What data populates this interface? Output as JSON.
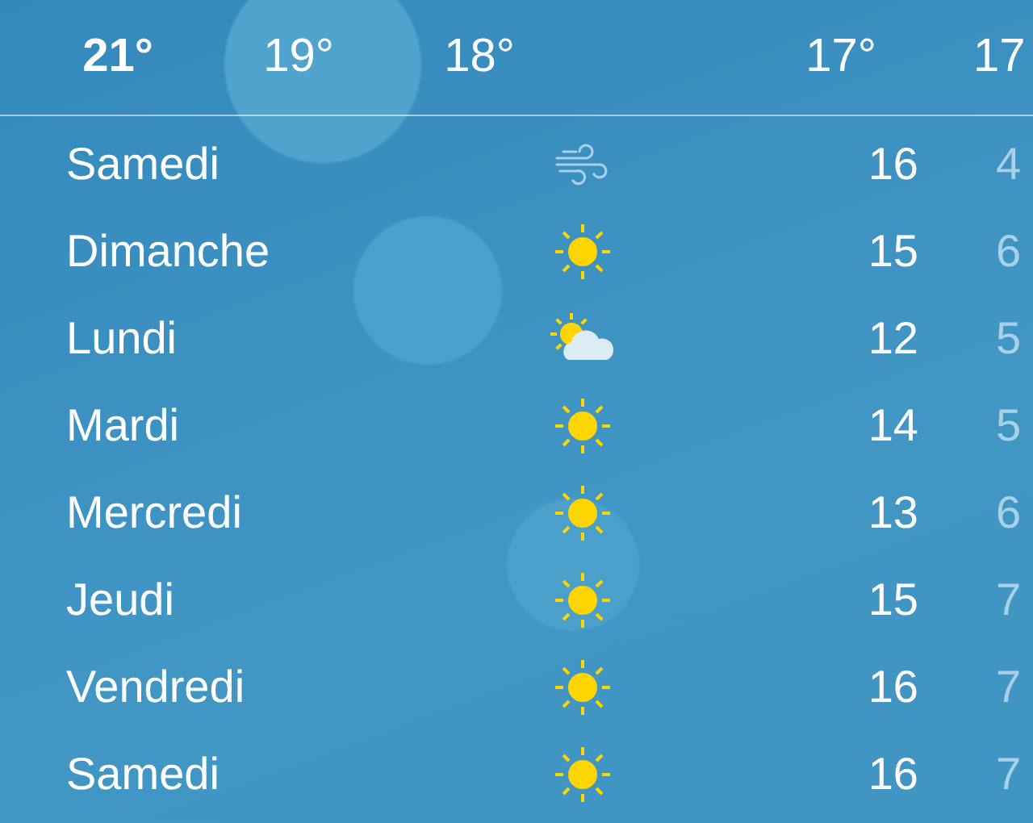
{
  "hourly": [
    {
      "temp": "21°",
      "selected": true
    },
    {
      "temp": "19°",
      "selected": false
    },
    {
      "temp": "18°",
      "selected": false
    },
    {
      "temp": "17°",
      "selected": false
    },
    {
      "temp": "17",
      "selected": false
    }
  ],
  "days": [
    {
      "day": "Samedi",
      "kind": "wind",
      "high": "16",
      "low": "4"
    },
    {
      "day": "Dimanche",
      "kind": "sun",
      "high": "15",
      "low": "6"
    },
    {
      "day": "Lundi",
      "kind": "partly-cloudy",
      "high": "12",
      "low": "5"
    },
    {
      "day": "Mardi",
      "kind": "sun",
      "high": "14",
      "low": "5"
    },
    {
      "day": "Mercredi",
      "kind": "sun",
      "high": "13",
      "low": "6"
    },
    {
      "day": "Jeudi",
      "kind": "sun",
      "high": "15",
      "low": "7"
    },
    {
      "day": "Vendredi",
      "kind": "sun",
      "high": "16",
      "low": "7"
    },
    {
      "day": "Samedi",
      "kind": "sun",
      "high": "16",
      "low": "7"
    }
  ]
}
